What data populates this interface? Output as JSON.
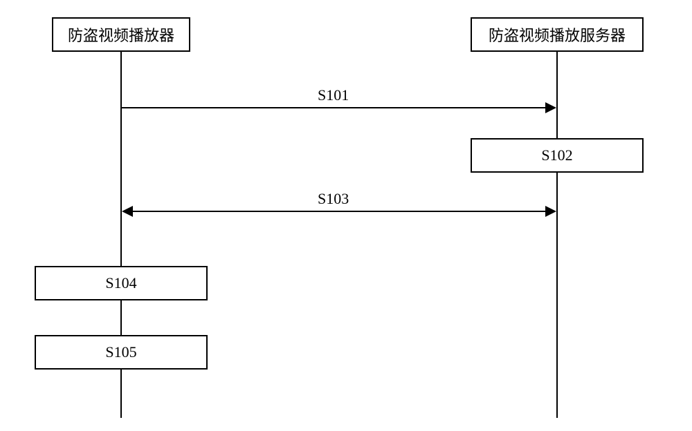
{
  "participants": {
    "left": "防盗视频播放器",
    "right": "防盗视频播放服务器"
  },
  "steps": {
    "s101": "S101",
    "s102": "S102",
    "s103": "S103",
    "s104": "S104",
    "s105": "S105"
  },
  "chart_data": {
    "type": "sequence",
    "participants": [
      "防盗视频播放器",
      "防盗视频播放服务器"
    ],
    "messages": [
      {
        "label": "S101",
        "from": "防盗视频播放器",
        "to": "防盗视频播放服务器",
        "direction": "right"
      },
      {
        "label": "S102",
        "at": "防盗视频播放服务器",
        "type": "activation"
      },
      {
        "label": "S103",
        "from": "防盗视频播放器",
        "to": "防盗视频播放服务器",
        "direction": "bidirectional"
      },
      {
        "label": "S104",
        "at": "防盗视频播放器",
        "type": "activation"
      },
      {
        "label": "S105",
        "at": "防盗视频播放器",
        "type": "activation"
      }
    ]
  }
}
